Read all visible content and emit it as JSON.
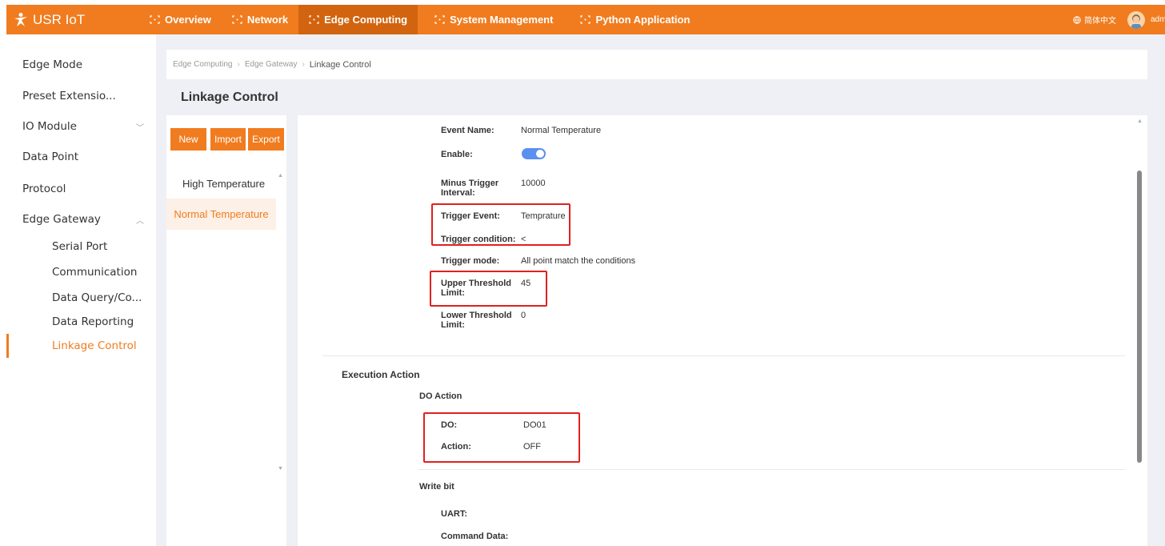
{
  "brand": {
    "name": "USR IoT"
  },
  "nav": [
    {
      "label": "Overview",
      "active": false
    },
    {
      "label": "Network",
      "active": false
    },
    {
      "label": "Edge Computing",
      "active": true
    },
    {
      "label": "System Management",
      "active": false
    },
    {
      "label": "Python Application",
      "active": false
    }
  ],
  "topright": {
    "language": "简体中文",
    "user": "admin"
  },
  "sidebar": {
    "items": [
      {
        "label": "Edge Mode"
      },
      {
        "label": "Preset Extensio..."
      },
      {
        "label": "IO Module",
        "expanded": false
      },
      {
        "label": "Data Point"
      },
      {
        "label": "Protocol"
      },
      {
        "label": "Edge Gateway",
        "expanded": true
      }
    ],
    "sub_items": [
      {
        "label": "Serial Port"
      },
      {
        "label": "Communication"
      },
      {
        "label": "Data Query/Co..."
      },
      {
        "label": "Data Reporting"
      },
      {
        "label": "Linkage Control",
        "active": true
      }
    ]
  },
  "breadcrumb": [
    "Edge Computing",
    "Edge Gateway",
    "Linkage Control"
  ],
  "page_title": "Linkage Control",
  "toolbar": {
    "new_label": "New",
    "import_label": "Import",
    "export_label": "Export"
  },
  "list": [
    {
      "label": "High Temperature",
      "selected": false
    },
    {
      "label": "Normal Temperature",
      "selected": true
    }
  ],
  "detail": {
    "event_name_label": "Event Name:",
    "event_name_value": "Normal Temperature",
    "enable_label": "Enable:",
    "enable_value": true,
    "minus_trigger_label_1": "Minus Trigger",
    "minus_trigger_label_2": "Interval:",
    "minus_trigger_value": "10000",
    "trigger_event_label": "Trigger Event:",
    "trigger_event_value": "Temprature",
    "trigger_condition_label": "Trigger condition:",
    "trigger_condition_value": "<",
    "trigger_mode_label": "Trigger mode:",
    "trigger_mode_value": "All point match the conditions",
    "upper_threshold_label_1": "Upper Threshold",
    "upper_threshold_label_2": "Limit:",
    "upper_threshold_value": "45",
    "lower_threshold_label_1": "Lower Threshold",
    "lower_threshold_label_2": "Limit:",
    "lower_threshold_value": "0",
    "execution_action_title": "Execution Action",
    "do_action_title": "DO Action",
    "do_label": "DO:",
    "do_value": "DO01",
    "action_label": "Action:",
    "action_value": "OFF",
    "write_bit_title": "Write bit",
    "uart_label": "UART:",
    "command_data_label": "Command Data:"
  },
  "colors": {
    "accent": "#f07c1f",
    "accent_dark": "#d2640f",
    "highlight": "#e02020",
    "toggle": "#5b8ff0"
  }
}
